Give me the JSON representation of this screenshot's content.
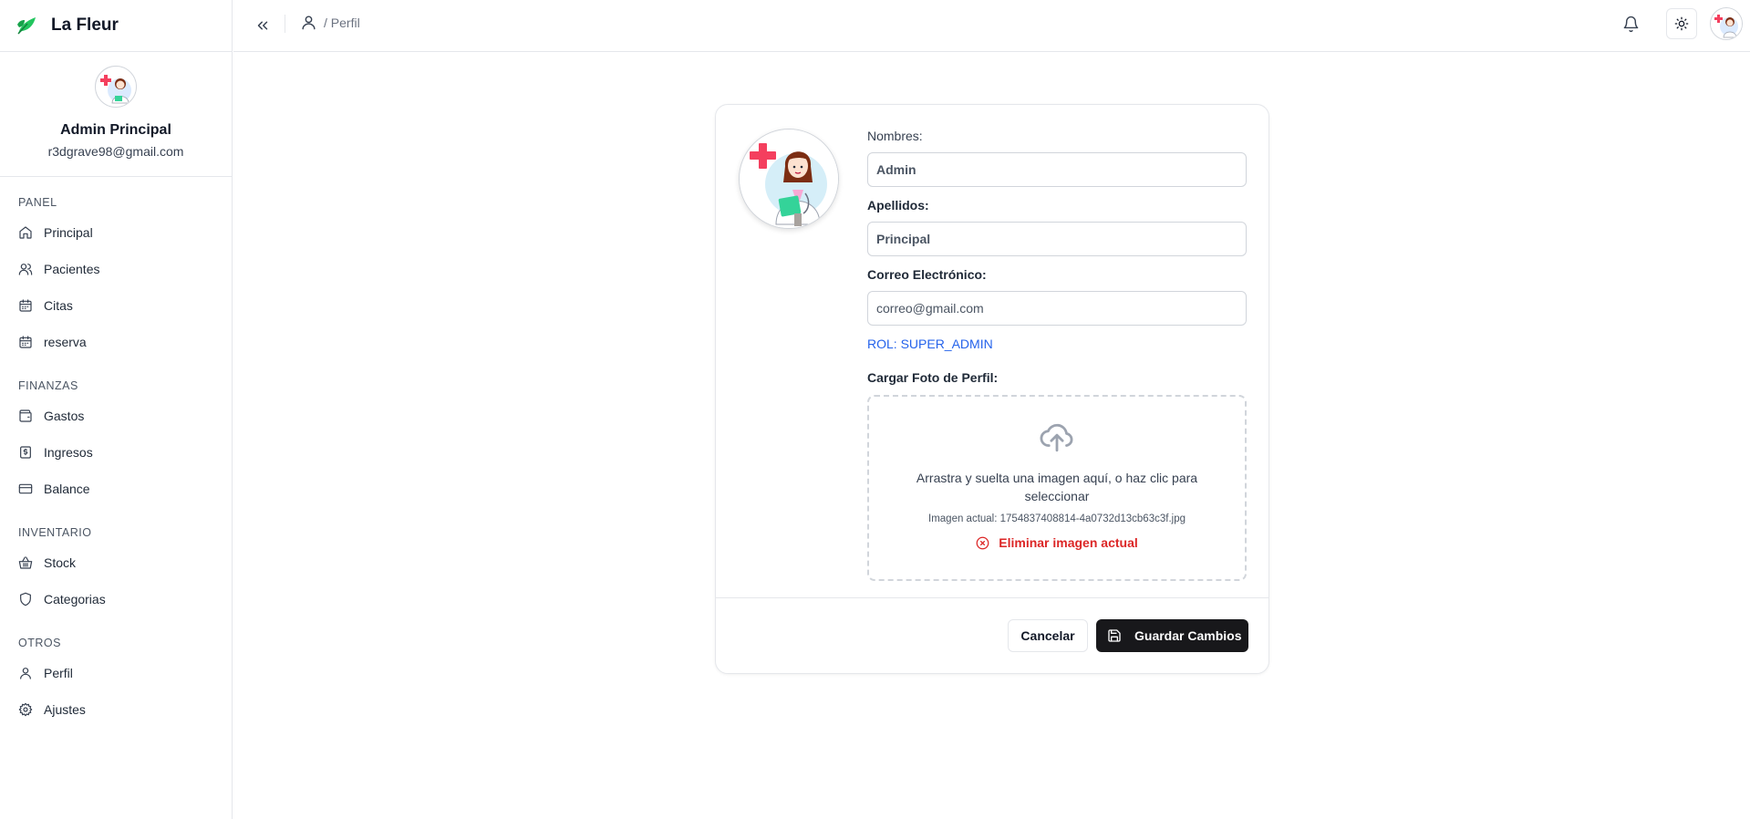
{
  "app": {
    "name": "La Fleur"
  },
  "user": {
    "name": "Admin Principal",
    "email": "r3dgrave98@gmail.com"
  },
  "sidebar": {
    "groups": [
      {
        "title": "PANEL",
        "items": [
          {
            "label": "Principal",
            "icon": "home-icon"
          },
          {
            "label": "Pacientes",
            "icon": "users-icon"
          },
          {
            "label": "Citas",
            "icon": "calendar-icon"
          },
          {
            "label": "reserva",
            "icon": "calendar-icon"
          }
        ]
      },
      {
        "title": "FINANZAS",
        "items": [
          {
            "label": "Gastos",
            "icon": "wallet-icon"
          },
          {
            "label": "Ingresos",
            "icon": "dollar-receipt-icon"
          },
          {
            "label": "Balance",
            "icon": "credit-card-icon"
          }
        ]
      },
      {
        "title": "INVENTARIO",
        "items": [
          {
            "label": "Stock",
            "icon": "basket-icon"
          },
          {
            "label": "Categorias",
            "icon": "shield-icon"
          }
        ]
      },
      {
        "title": "OTROS",
        "items": [
          {
            "label": "Perfil",
            "icon": "user-icon"
          },
          {
            "label": "Ajustes",
            "icon": "gear-icon"
          }
        ]
      }
    ]
  },
  "header": {
    "breadcrumb": "/ Perfil"
  },
  "form": {
    "nombres_label": "Nombres:",
    "nombres_value": "Admin",
    "apellidos_label": "Apellidos:",
    "apellidos_value": "Principal",
    "correo_label": "Correo Electrónico:",
    "correo_value": "correo@gmail.com",
    "role": "ROL: SUPER_ADMIN",
    "upload_label": "Cargar Foto de Perfil:",
    "dropzone_text": "Arrastra y suelta una imagen aquí, o haz clic para seleccionar",
    "current_image": "Imagen actual: 1754837408814-4a0732d13cb63c3f.jpg",
    "remove_label": "Eliminar imagen actual"
  },
  "actions": {
    "cancel": "Cancelar",
    "save": "Guardar Cambios"
  },
  "colors": {
    "brand_green": "#22c55e",
    "role_blue": "#2563eb",
    "danger": "#dc2626",
    "primary_button": "#18181b"
  }
}
